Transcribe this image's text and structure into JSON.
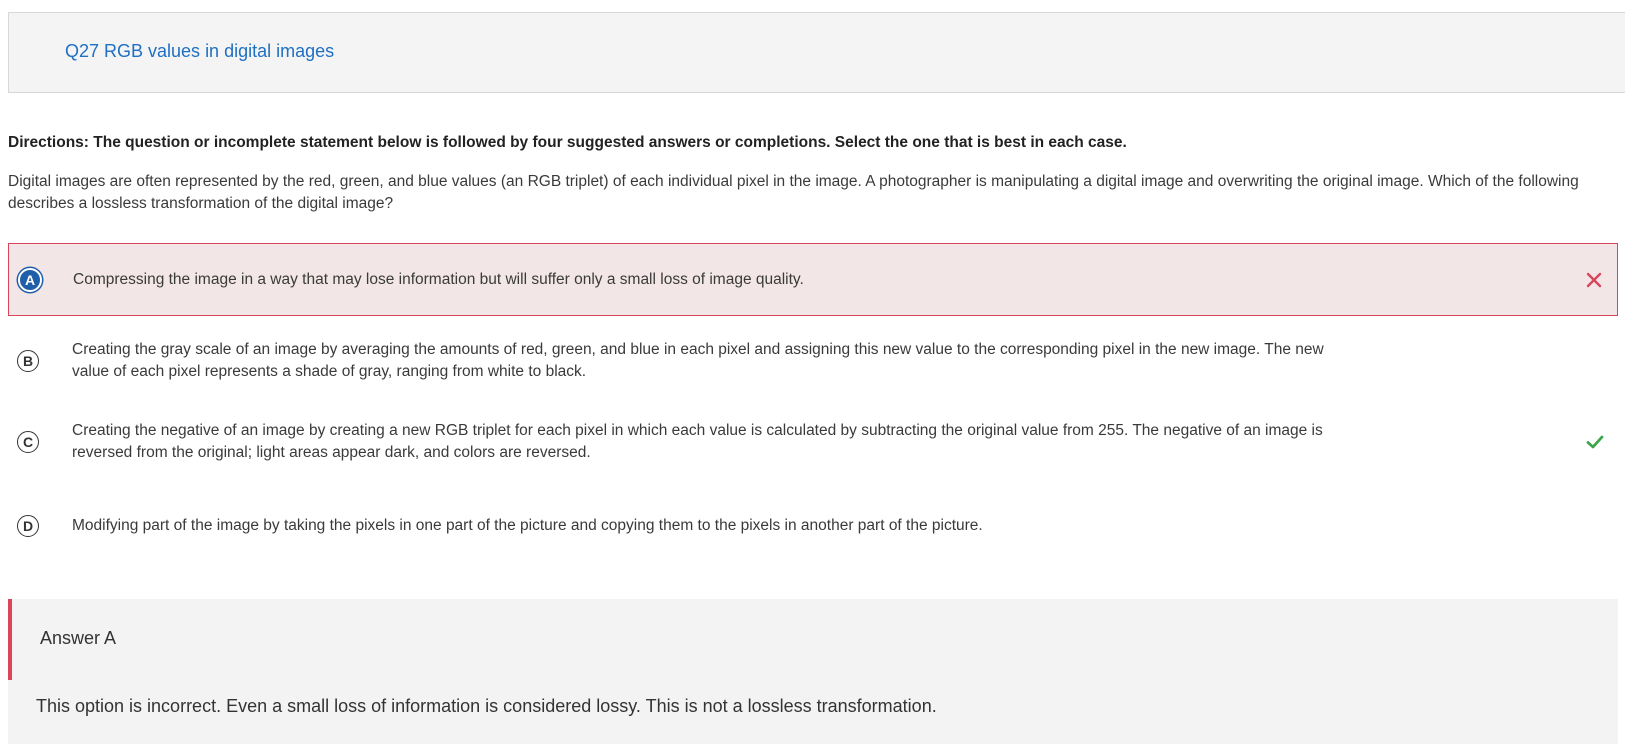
{
  "header": {
    "title": "Q27 RGB values in digital images"
  },
  "directions": "Directions: The question or incomplete statement below is followed by four suggested answers or completions. Select the one that is best in each case.",
  "question": "Digital images are often represented by the red, green, and blue values (an RGB triplet) of each individual pixel in the image. A photographer is manipulating a digital image and overwriting the original image. Which of the following describes a lossless transformation of the digital image?",
  "options": [
    {
      "letter": "A",
      "text": "Compressing the image in a way that may lose information but will suffer only a small loss of image quality.",
      "state": "selected-incorrect"
    },
    {
      "letter": "B",
      "text": "Creating the gray scale of an image by averaging the amounts of red, green, and blue in each pixel and assigning this new value to the corresponding pixel in the new image. The new value of each pixel represents a shade of gray, ranging from white to black.",
      "state": "unselected"
    },
    {
      "letter": "C",
      "text": "Creating the negative of an image by creating a new RGB triplet for each pixel in which each value is calculated by subtracting the original value from 255. The negative of an image is reversed from the original; light areas appear dark, and colors are reversed.",
      "state": "correct"
    },
    {
      "letter": "D",
      "text": "Modifying part of the image by taking the pixels in one part of the picture and copying them to the pixels in another part of the picture.",
      "state": "unselected"
    }
  ],
  "feedback": {
    "heading": "Answer A",
    "text": "This option is incorrect. Even a small loss of information is considered lossy. This is not a lossless transformation."
  },
  "colors": {
    "title_blue": "#1f6fc2",
    "selected_fill": "#1f5faa",
    "incorrect_red": "#d9455a",
    "correct_green": "#3aa64a"
  },
  "icons": {
    "incorrect": "x-icon",
    "correct": "checkmark-icon"
  }
}
